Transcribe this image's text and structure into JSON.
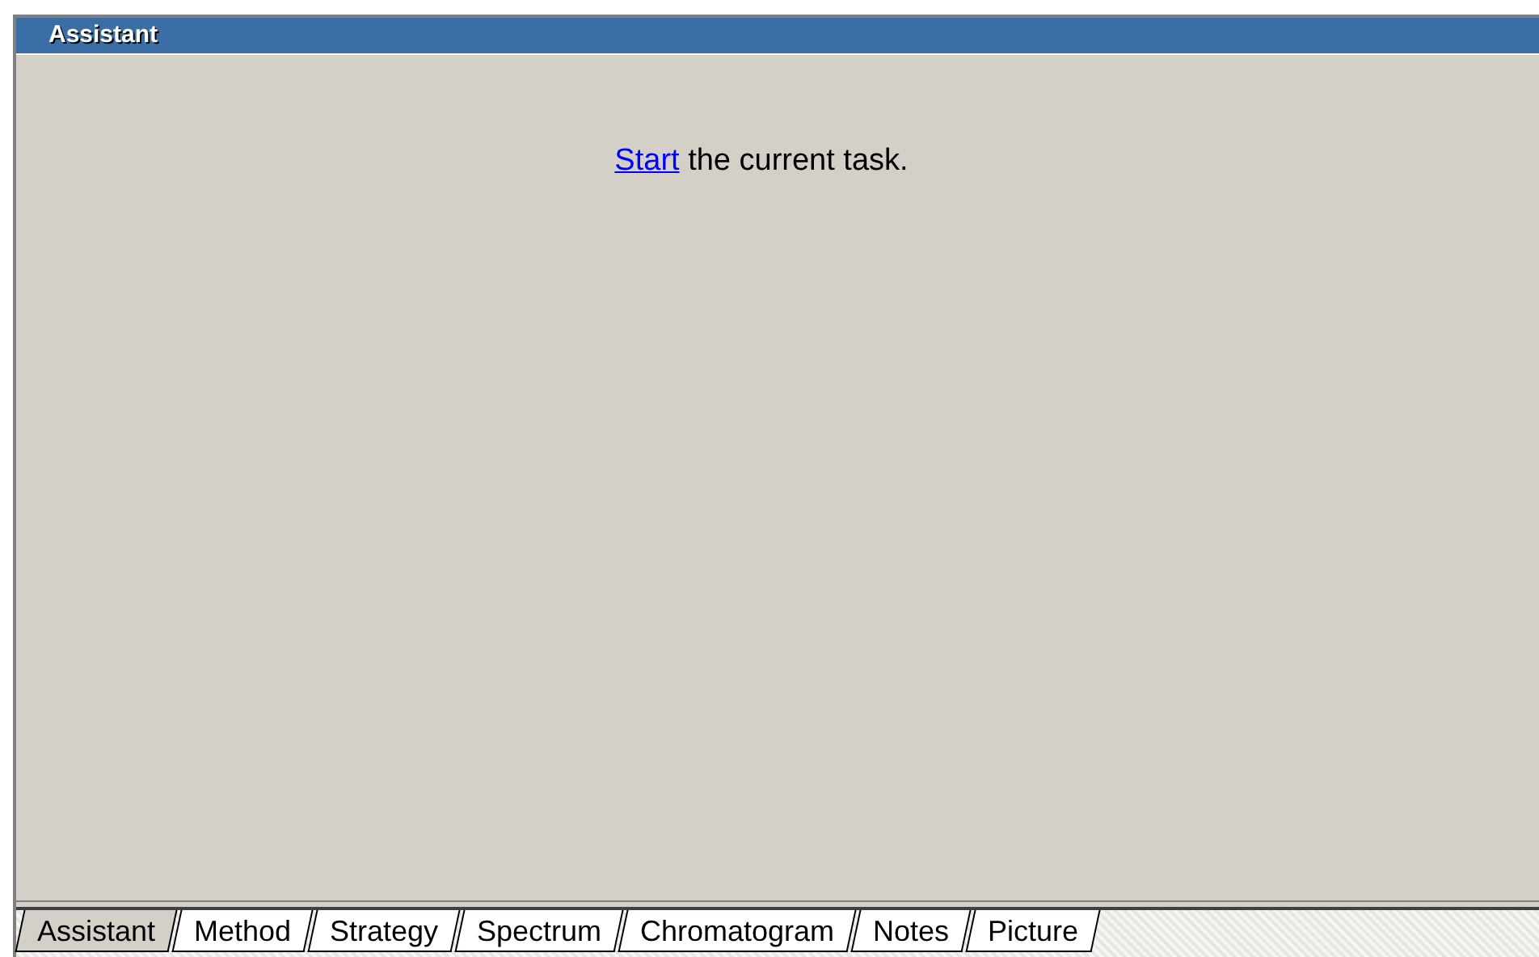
{
  "panel": {
    "title": "Assistant"
  },
  "message": {
    "link": "Start",
    "text": "the current task."
  },
  "tabs": [
    {
      "label": "Assistant",
      "selected": true
    },
    {
      "label": "Method",
      "selected": false
    },
    {
      "label": "Strategy",
      "selected": false
    },
    {
      "label": "Spectrum",
      "selected": false
    },
    {
      "label": "Chromatogram",
      "selected": false
    },
    {
      "label": "Notes",
      "selected": false
    },
    {
      "label": "Picture",
      "selected": false
    }
  ]
}
